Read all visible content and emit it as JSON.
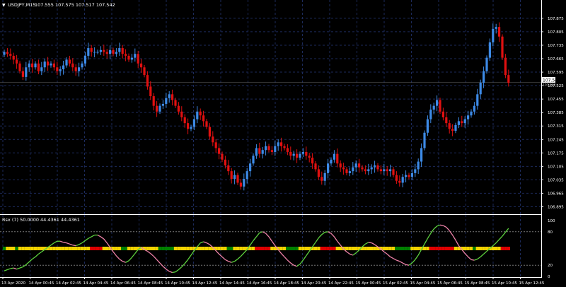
{
  "header": {
    "symbol": "USDJPY,M15",
    "ohlc": "107.555 107.575 107.517 107.542"
  },
  "indicator": {
    "label": "Rsx (7) 50.0000 44.4361 44.4361",
    "levels": [
      "100",
      "80",
      "20",
      "0"
    ]
  },
  "price_axis": {
    "labels": [
      "107.875",
      "107.805",
      "107.735",
      "107.665",
      "107.595",
      "107.525",
      "107.455",
      "107.385",
      "107.315",
      "107.245",
      "107.175",
      "107.105",
      "107.035",
      "106.965",
      "106.895"
    ],
    "current": "107.542",
    "bid_line": "107.542"
  },
  "time_axis": [
    "13 Apr 2020",
    "14 Apr 00:45",
    "14 Apr 02:45",
    "14 Apr 04:45",
    "14 Apr 06:45",
    "14 Apr 08:45",
    "14 Apr 10:45",
    "14 Apr 12:45",
    "14 Apr 14:45",
    "14 Apr 16:45",
    "14 Apr 18:45",
    "14 Apr 20:45",
    "14 Apr 22:45",
    "15 Apr 00:45",
    "15 Apr 02:45",
    "15 Apr 04:45",
    "15 Apr 06:45",
    "15 Apr 08:45",
    "15 Apr 10:45",
    "15 Apr 12:45"
  ],
  "colors": {
    "bull": "#3d8ae6",
    "bear": "#e01010",
    "grid": "#1c2a5a",
    "rsx_up": "#5dd13e",
    "rsx_down": "#ee82a8",
    "bar_yellow": "#f2d300",
    "bar_green": "#008000",
    "bar_red": "#e00000"
  },
  "chart_data": {
    "type": "candlestick",
    "symbol": "USDJPY,M15",
    "ylim": [
      106.86,
      107.915
    ],
    "close": [
      107.7,
      107.69,
      107.68,
      107.66,
      107.64,
      107.6,
      107.57,
      107.62,
      107.64,
      107.62,
      107.64,
      107.6,
      107.62,
      107.65,
      107.63,
      107.64,
      107.62,
      107.6,
      107.61,
      107.63,
      107.66,
      107.64,
      107.62,
      107.6,
      107.62,
      107.64,
      107.68,
      107.72,
      107.7,
      107.7,
      107.7,
      107.71,
      107.7,
      107.69,
      107.71,
      107.69,
      107.7,
      107.72,
      107.69,
      107.68,
      107.66,
      107.67,
      107.69,
      107.64,
      107.62,
      107.58,
      107.52,
      107.47,
      107.42,
      107.39,
      107.42,
      107.43,
      107.46,
      107.48,
      107.45,
      107.42,
      107.39,
      107.36,
      107.33,
      107.3,
      107.31,
      107.35,
      107.39,
      107.37,
      107.34,
      107.31,
      107.26,
      107.23,
      107.2,
      107.17,
      107.14,
      107.11,
      107.08,
      107.04,
      107.06,
      107.02,
      107.0,
      107.04,
      107.08,
      107.12,
      107.16,
      107.2,
      107.17,
      107.19,
      107.21,
      107.19,
      107.18,
      107.21,
      107.23,
      107.21,
      107.2,
      107.18,
      107.16,
      107.17,
      107.15,
      107.17,
      107.18,
      107.16,
      107.15,
      107.12,
      107.09,
      107.05,
      107.03,
      107.07,
      107.12,
      107.14,
      107.17,
      107.12,
      107.1,
      107.09,
      107.07,
      107.08,
      107.1,
      107.12,
      107.1,
      107.09,
      107.08,
      107.09,
      107.1,
      107.11,
      107.09,
      107.08,
      107.09,
      107.08,
      107.09,
      107.06,
      107.03,
      107.02,
      107.05,
      107.06,
      107.05,
      107.07,
      107.09,
      107.13,
      107.2,
      107.28,
      107.35,
      107.4,
      107.42,
      107.45,
      107.39,
      107.36,
      107.33,
      107.3,
      107.29,
      107.32,
      107.34,
      107.33,
      107.35,
      107.37,
      107.39,
      107.42,
      107.48,
      107.54,
      107.6,
      107.67,
      107.75,
      107.82,
      107.83,
      107.78,
      107.67,
      107.58,
      107.54
    ],
    "rsx": [
      10,
      12,
      14,
      15,
      13,
      15,
      17,
      21,
      26,
      31,
      35,
      40,
      44,
      48,
      52,
      56,
      60,
      63,
      63,
      61,
      60,
      58,
      56,
      55,
      57,
      60,
      64,
      68,
      71,
      74,
      74,
      71,
      67,
      60,
      52,
      44,
      37,
      31,
      27,
      25,
      28,
      34,
      41,
      48,
      52,
      48,
      45,
      41,
      36,
      30,
      24,
      18,
      13,
      9,
      7,
      8,
      12,
      17,
      23,
      30,
      38,
      46,
      53,
      60,
      62,
      60,
      57,
      52,
      46,
      40,
      35,
      30,
      27,
      25,
      27,
      31,
      36,
      42,
      48,
      56,
      64,
      71,
      78,
      80,
      77,
      71,
      63,
      55,
      48,
      41,
      35,
      29,
      24,
      20,
      18,
      22,
      29,
      37,
      45,
      53,
      61,
      69,
      75,
      79,
      80,
      77,
      71,
      63,
      56,
      49,
      44,
      40,
      38,
      42,
      47,
      53,
      58,
      61,
      60,
      57,
      53,
      49,
      44,
      40,
      35,
      32,
      29,
      27,
      24,
      21,
      20,
      24,
      30,
      38,
      48,
      58,
      68,
      77,
      85,
      90,
      92,
      91,
      88,
      82,
      74,
      65,
      55,
      48,
      41,
      35,
      30,
      29,
      31,
      35,
      40,
      45,
      50,
      55,
      60,
      66,
      72,
      79,
      86,
      89,
      86,
      80,
      72,
      62,
      56,
      48
    ]
  }
}
